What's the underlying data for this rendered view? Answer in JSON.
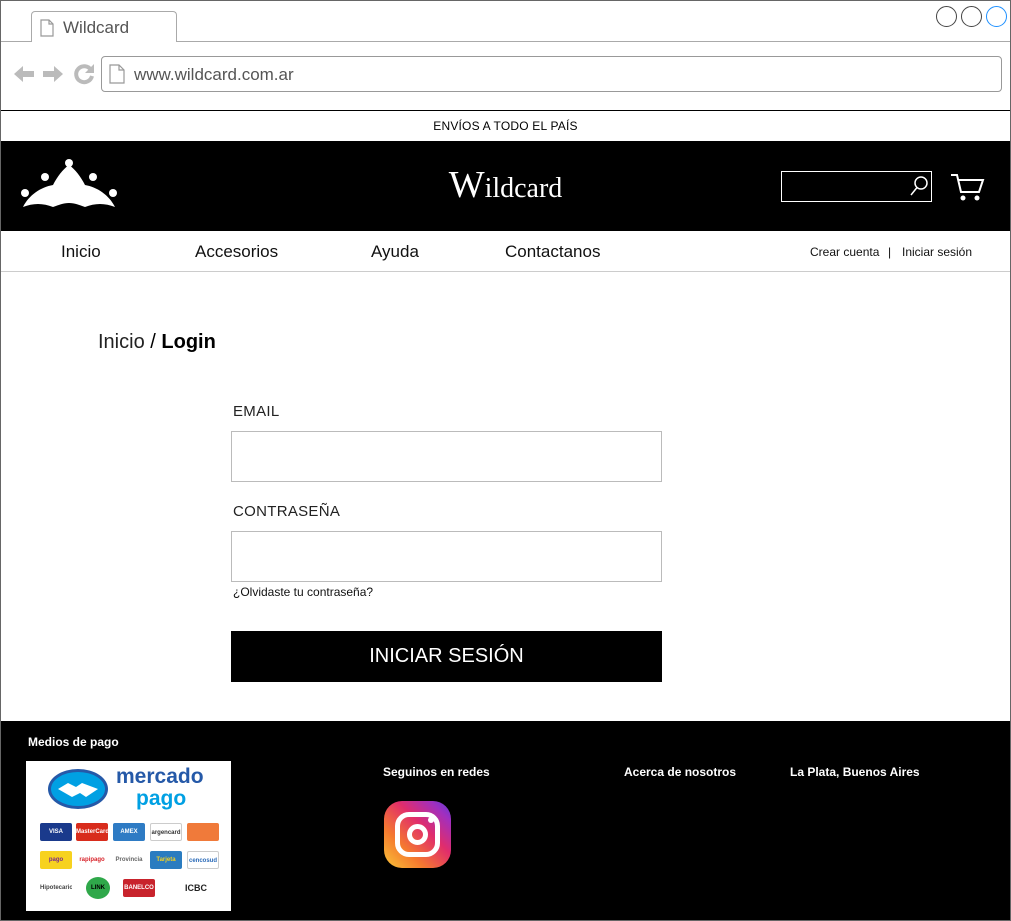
{
  "browser": {
    "tab_title": "Wildcard",
    "url": "www.wildcard.com.ar"
  },
  "announcement": "ENVÍOS A TODO EL PAÍS",
  "header": {
    "brand_initial": "W",
    "brand_rest": "ildcard",
    "search_placeholder": "",
    "colors": {
      "background": "#000000",
      "text": "#ffffff"
    }
  },
  "nav": {
    "items": [
      "Inicio",
      "Accesorios",
      "Ayuda",
      "Contactanos"
    ],
    "create_account": "Crear cuenta",
    "separator": "|",
    "login": "Iniciar sesión"
  },
  "breadcrumb": {
    "home": "Inicio",
    "separator": "/",
    "current": "Login"
  },
  "form": {
    "email_label": "EMAIL",
    "email_value": "",
    "password_label": "CONTRASEÑA",
    "password_value": "",
    "forgot_link": "¿Olvidaste tu contraseña?",
    "submit_label": "INICIAR SESIÓN"
  },
  "footer": {
    "payments_title": "Medios de pago",
    "mercado_line1": "mercado",
    "mercado_line2": "pago",
    "social_title": "Seguinos en redes",
    "about_title": "Acerca de nosotros",
    "location_title": "La Plata, Buenos Aires",
    "payment_cards": [
      "VISA",
      "MasterCard",
      "AMEX",
      "argencard",
      "",
      "pago",
      "rapipago",
      "Provincia",
      "Tarjeta",
      "cencosud",
      "Hipotecario",
      "LINK",
      "BANELCO",
      "ICBC"
    ]
  }
}
